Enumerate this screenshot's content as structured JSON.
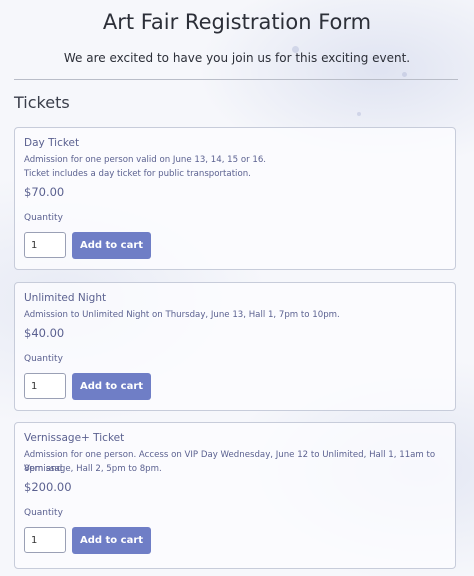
{
  "header": {
    "title": "Art Fair Registration Form",
    "subtitle": "We are excited to have you join us for this exciting event."
  },
  "section": {
    "title": "Tickets"
  },
  "tickets": [
    {
      "name": "Day Ticket",
      "description_lines": [
        "Admission for one person valid on June 13, 14, 15 or 16.",
        "Ticket includes a day ticket for public transportation."
      ],
      "price": "$70.00",
      "quantity_label": "Quantity",
      "quantity_value": "1",
      "button_label": "Add to cart"
    },
    {
      "name": "Unlimited Night",
      "description_lines": [
        "Admission to Unlimited Night on Thursday, June 13, Hall 1, 7pm to 10pm."
      ],
      "price": "$40.00",
      "quantity_label": "Quantity",
      "quantity_value": "1",
      "button_label": "Add to cart"
    },
    {
      "name": "Vernissage+ Ticket",
      "description_lines": [
        "Admission for one person. Access on VIP Day Wednesday, June 12 to Unlimited, Hall 1, 11am to 8pm and",
        "Vernissage, Hall 2, 5pm to 8pm."
      ],
      "price": "$200.00",
      "quantity_label": "Quantity",
      "quantity_value": "1",
      "button_label": "Add to cart"
    }
  ],
  "colors": {
    "accent": "#6f7ec6",
    "ticket_text": "#5b6190",
    "card_border": "#c7ccda"
  }
}
